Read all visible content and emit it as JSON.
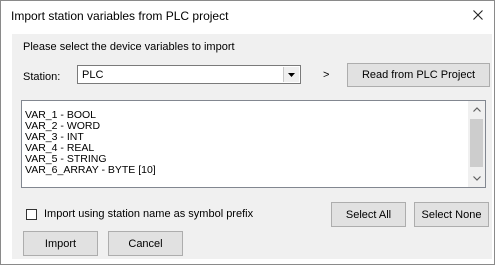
{
  "window": {
    "title": "Import station variables from PLC project"
  },
  "dialog": {
    "instruction": "Please select the device variables to import",
    "station_label": "Station:",
    "station_value": "PLC",
    "arrow_text": ">",
    "read_button": "Read from PLC Project",
    "variables": [
      "VAR_1 - BOOL",
      "VAR_2 - WORD",
      "VAR_3 - INT",
      "VAR_4 - REAL",
      "VAR_5 - STRING",
      "VAR_6_ARRAY - BYTE [10]"
    ],
    "prefix_checkbox_label": "Import using station name as symbol prefix",
    "prefix_checked": false,
    "select_all": "Select All",
    "select_none": "Select None",
    "import": "Import",
    "cancel": "Cancel"
  },
  "icons": {
    "close": "close-icon",
    "dropdown": "chevron-down-icon",
    "scroll_up": "scroll-up-icon",
    "scroll_down": "scroll-down-icon"
  }
}
